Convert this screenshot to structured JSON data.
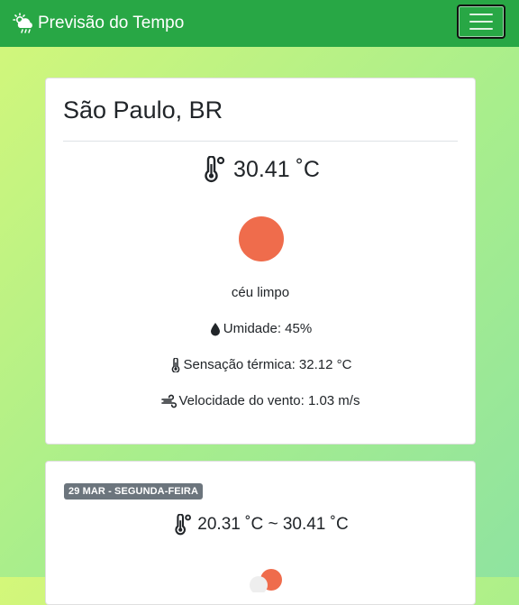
{
  "navbar": {
    "brand": "Previsão do Tempo",
    "brand_icon": "sun-cloud-rain-icon",
    "menu_icon": "hamburger-icon"
  },
  "current": {
    "city": "São Paulo, BR",
    "temperature": "30.41 ˚C",
    "icon": "clear-sky-sun-icon",
    "icon_color": "#ef6c4c",
    "description": "céu limpo",
    "humidity": "Umidade: 45%",
    "feels_like": "Sensação térmica: 32.12 °C",
    "wind": "Velocidade do vento: 1.03 m/s"
  },
  "forecast": [
    {
      "date_badge": "29 MAR - SEGUNDA-FEIRA",
      "range": "20.31 ˚C ~ 30.41 ˚C"
    }
  ],
  "colors": {
    "navbar": "#28a745",
    "badge": "#6c757d",
    "sun": "#ef6c4c"
  }
}
